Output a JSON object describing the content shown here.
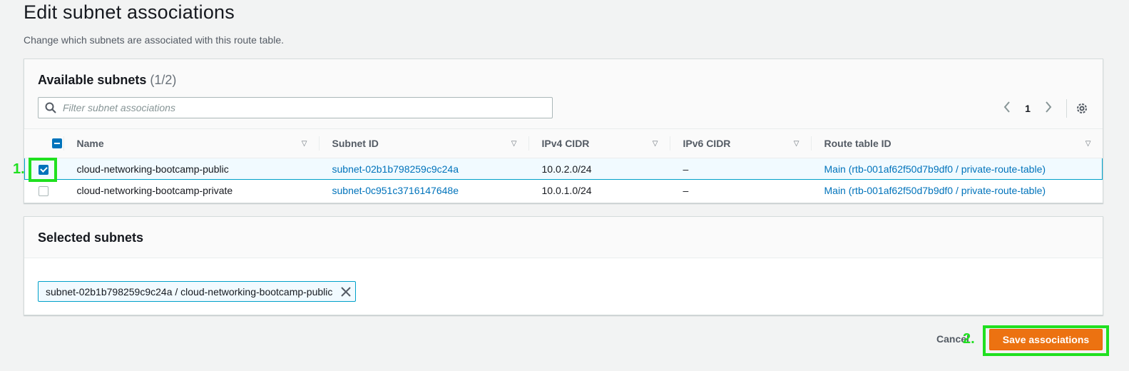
{
  "page": {
    "title": "Edit subnet associations",
    "description": "Change which subnets are associated with this route table."
  },
  "available": {
    "title": "Available subnets",
    "count": "(1/2)",
    "filter_placeholder": "Filter subnet associations",
    "pager": {
      "current_page": "1"
    },
    "columns": [
      "Name",
      "Subnet ID",
      "IPv4 CIDR",
      "IPv6 CIDR",
      "Route table ID"
    ],
    "rows": [
      {
        "selected": true,
        "name": "cloud-networking-bootcamp-public",
        "subnet_id": "subnet-02b1b798259c9c24a",
        "ipv4": "10.0.2.0/24",
        "ipv6": "–",
        "route_table": "Main (rtb-001af62f50d7b9df0 / private-route-table)"
      },
      {
        "selected": false,
        "name": "cloud-networking-bootcamp-private",
        "subnet_id": "subnet-0c951c3716147648e",
        "ipv4": "10.0.1.0/24",
        "ipv6": "–",
        "route_table": "Main (rtb-001af62f50d7b9df0 / private-route-table)"
      }
    ]
  },
  "selected": {
    "title": "Selected subnets",
    "tokens": [
      "subnet-02b1b798259c9c24a / cloud-networking-bootcamp-public"
    ]
  },
  "footer": {
    "cancel_label": "Cancel",
    "save_label": "Save associations"
  },
  "annotations": {
    "step1": "1.",
    "step2": "2.",
    "color": "#20e020"
  },
  "colors": {
    "primary": "#ec7211",
    "link": "#0073bb",
    "selection": "#00a1c9"
  }
}
